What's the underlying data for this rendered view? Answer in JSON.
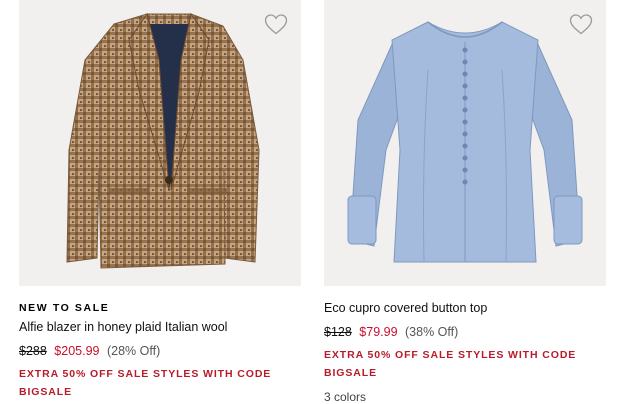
{
  "products": [
    {
      "badge": "NEW TO SALE",
      "name": "Alfie blazer in honey plaid Italian wool",
      "price_original": "$288",
      "price_sale": "$205.99",
      "price_discount": "(28% Off)",
      "promo": "EXTRA 50% OFF SALE STYLES WITH CODE BIGSALE",
      "image_icon": "plaid-blazer-image",
      "wishlist_icon": "heart-icon"
    },
    {
      "badge": "",
      "name": "Eco cupro covered button top",
      "price_original": "$128",
      "price_sale": "$79.99",
      "price_discount": "(38% Off)",
      "promo": "EXTRA 50% OFF SALE STYLES WITH CODE BIGSALE",
      "colors": "3 colors",
      "image_icon": "blue-blouse-image",
      "wishlist_icon": "heart-icon"
    }
  ],
  "colors": {
    "image_bg": "#f1f0ee",
    "sale_red": "#c8102e",
    "promo_red": "#b71c2b",
    "blazer_tan": "#b8926a",
    "blouse_blue": "#9db4d8"
  }
}
